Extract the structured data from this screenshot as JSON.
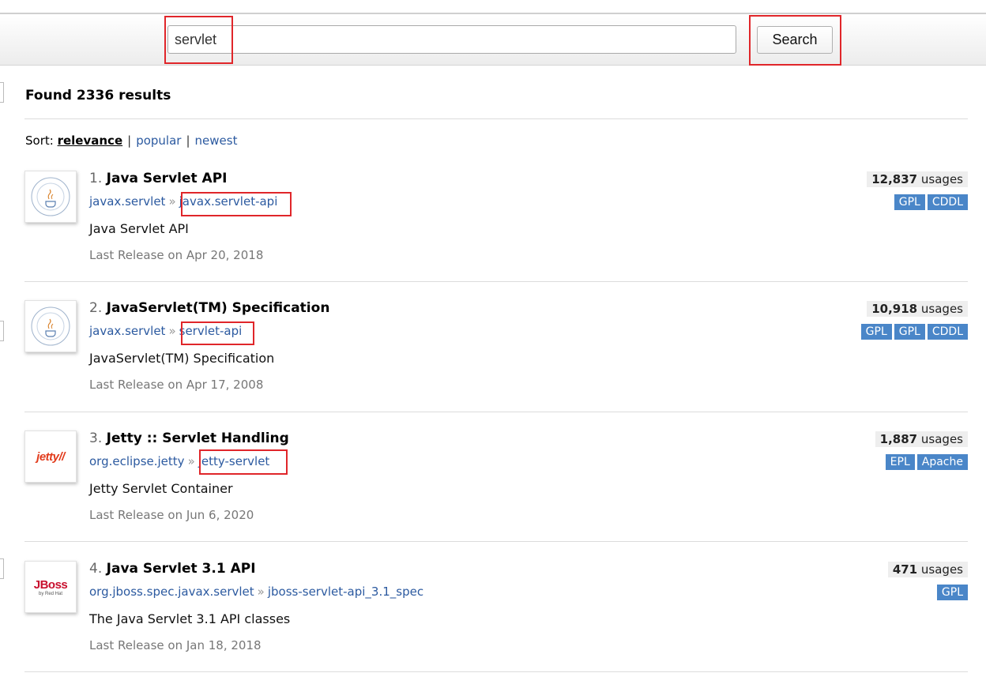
{
  "search": {
    "value": "servlet",
    "button": "Search"
  },
  "results_header": "Found 2336 results",
  "sort": {
    "label": "Sort:",
    "options": [
      "relevance",
      "popular",
      "newest"
    ],
    "selected": "relevance"
  },
  "results": [
    {
      "index": "1.",
      "title": "Java Servlet API",
      "group": "javax.servlet",
      "artifact": "javax.servlet-api",
      "description": "Java Servlet API",
      "release": "Last Release on Apr 20, 2018",
      "usages_count": "12,837",
      "usages_label": "usages",
      "licenses": [
        "GPL",
        "CDDL"
      ],
      "logo": "java-community-process-logo"
    },
    {
      "index": "2.",
      "title": "JavaServlet(TM) Specification",
      "group": "javax.servlet",
      "artifact": "servlet-api",
      "description": "JavaServlet(TM) Specification",
      "release": "Last Release on Apr 17, 2008",
      "usages_count": "10,918",
      "usages_label": "usages",
      "licenses": [
        "GPL",
        "GPL",
        "CDDL"
      ],
      "logo": "java-community-process-logo"
    },
    {
      "index": "3.",
      "title": "Jetty :: Servlet Handling",
      "group": "org.eclipse.jetty",
      "artifact": "jetty-servlet",
      "description": "Jetty Servlet Container",
      "release": "Last Release on Jun 6, 2020",
      "usages_count": "1,887",
      "usages_label": "usages",
      "licenses": [
        "EPL",
        "Apache"
      ],
      "logo": "jetty-logo"
    },
    {
      "index": "4.",
      "title": "Java Servlet 3.1 API",
      "group": "org.jboss.spec.javax.servlet",
      "artifact": "jboss-servlet-api_3.1_spec",
      "description": "The Java Servlet 3.1 API classes",
      "release": "Last Release on Jan 18, 2018",
      "usages_count": "471",
      "usages_label": "usages",
      "licenses": [
        "GPL"
      ],
      "logo": "jboss-logo"
    }
  ],
  "colors": {
    "link": "#2c5aa0",
    "license_badge": "#4a86c8",
    "highlight": "#e0262a"
  },
  "logos": {
    "jetty_text": "jetty//",
    "jboss_text": "JBoss",
    "jboss_sub": "by Red Hat"
  }
}
